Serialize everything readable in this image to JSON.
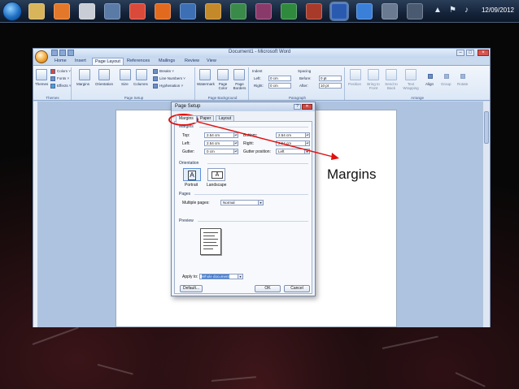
{
  "taskbar": {
    "clock_date": "12/09/2012",
    "tray_symbols": [
      "▲",
      "⚑",
      "♪"
    ]
  },
  "word": {
    "title": "Document1 - Microsoft Word",
    "ribbon_tabs": [
      "Home",
      "Insert",
      "Page Layout",
      "References",
      "Mailings",
      "Review",
      "View"
    ],
    "active_tab": "Page Layout",
    "themes_group": {
      "name": "Themes",
      "themes_label": "Themes",
      "colors_label": "Colors ˅",
      "fonts_label": "Fonts ˅",
      "effects_label": "Effects ˅"
    },
    "page_setup_group": {
      "name": "Page Setup",
      "margins_label": "Margins",
      "orientation_label": "Orientation",
      "size_label": "Size",
      "columns_label": "Columns",
      "breaks_label": "Breaks ˅",
      "line_numbers_label": "Line Numbers ˅",
      "hyphenation_label": "Hyphenation ˅"
    },
    "page_background_group": {
      "name": "Page Background",
      "watermark_label": "Watermark",
      "page_color_label": "Page Color",
      "page_borders_label": "Page Borders"
    },
    "paragraph_group": {
      "name": "Paragraph",
      "indent_label": "Indent",
      "left_label": "Left:",
      "left_value": "0 cm",
      "right_label": "Right:",
      "right_value": "0 cm",
      "spacing_label": "Spacing",
      "before_label": "Before:",
      "before_value": "0 pt",
      "after_label": "After:",
      "after_value": "10 pt"
    },
    "arrange_group": {
      "name": "Arrange",
      "position_label": "Position",
      "bring_front_label": "Bring to Front",
      "send_back_label": "Send to Back",
      "text_wrapping_label": "Text Wrapping",
      "align_label": "Align",
      "group_label": "Group",
      "rotate_label": "Rotate"
    }
  },
  "dialog": {
    "title": "Page Setup",
    "help_symbol": "?",
    "close_symbol": "✕",
    "tabs": [
      "Margins",
      "Paper",
      "Layout"
    ],
    "margins_section": "Margins",
    "top_label": "Top:",
    "top_value": "2.54 cm",
    "bottom_label": "Bottom:",
    "bottom_value": "2.54 cm",
    "left_label": "Left:",
    "left_value": "2.54 cm",
    "right_label": "Right:",
    "right_value": "2.54 cm",
    "gutter_label": "Gutter:",
    "gutter_value": "0 cm",
    "gutter_position_label": "Gutter position:",
    "gutter_position_value": "Left",
    "orientation_section": "Orientation",
    "portrait_label": "Portrait",
    "landscape_label": "Landscape",
    "orientation_glyph": "A",
    "pages_section": "Pages",
    "multiple_pages_label": "Multiple pages:",
    "multiple_pages_value": "Normal",
    "preview_section": "Preview",
    "apply_to_label": "Apply to:",
    "apply_to_value": "Whole document",
    "default_button": "Default...",
    "ok_button": "OK",
    "cancel_button": "Cancel"
  },
  "annotation": {
    "callout_text": "Margins",
    "color": "#e01010"
  }
}
